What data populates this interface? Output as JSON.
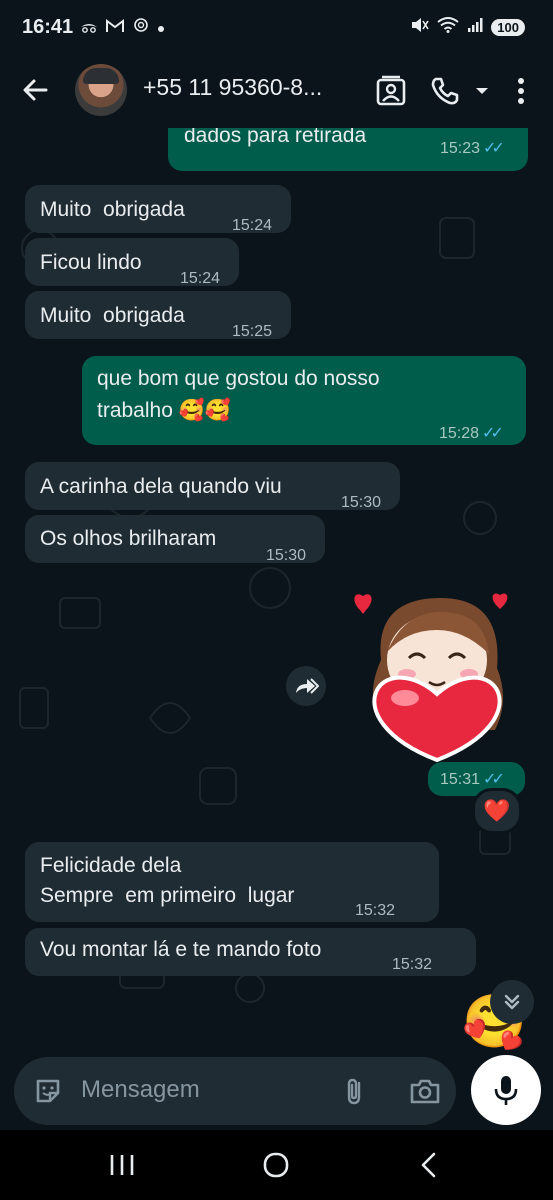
{
  "status_bar": {
    "time": "16:41",
    "battery": "100",
    "notification_icons": [
      "incognito-icon",
      "gmail-icon",
      "chatgpt-icon",
      "dot-icon"
    ],
    "system_icons": [
      "mute-icon",
      "wifi-icon",
      "signal-icon",
      "battery-icon"
    ]
  },
  "header": {
    "contact": "+55 11 95360-8...",
    "icons": [
      "back-arrow-icon",
      "avatar",
      "contact-card-icon",
      "phone-icon",
      "dropdown-icon",
      "more-icon"
    ]
  },
  "messages": [
    {
      "id": "m1",
      "dir": "out",
      "text": "dados para retirada",
      "time": "15:23",
      "status": "read"
    },
    {
      "id": "m2",
      "dir": "in",
      "text": "Muito  obrigada",
      "time": "15:24"
    },
    {
      "id": "m3",
      "dir": "in",
      "text": "Ficou lindo",
      "time": "15:24"
    },
    {
      "id": "m4",
      "dir": "in",
      "text": "Muito  obrigada",
      "time": "15:25"
    },
    {
      "id": "m5",
      "dir": "out",
      "text_line1": "que bom que gostou do nosso",
      "text_line2": "trabalho 🥰🥰",
      "time": "15:28",
      "status": "read"
    },
    {
      "id": "m6",
      "dir": "in",
      "text": "A carinha dela quando viu",
      "time": "15:30"
    },
    {
      "id": "m7",
      "dir": "in",
      "text": "Os olhos brilharam",
      "time": "15:30"
    },
    {
      "id": "m8",
      "dir": "out",
      "type": "sticker",
      "time": "15:31",
      "status": "read",
      "reaction": "❤️"
    },
    {
      "id": "m9",
      "dir": "in",
      "text_line1": "Felicidade dela",
      "text_line2": "Sempre  em primeiro  lugar",
      "time": "15:32"
    },
    {
      "id": "m10",
      "dir": "in",
      "text": "Vou montar lá e te mando foto",
      "time": "15:32"
    }
  ],
  "read_ticks": "✓✓",
  "floating_emoji": "🥰",
  "input": {
    "placeholder": "Mensagem"
  },
  "nav": [
    "recents-icon",
    "home-icon",
    "back-icon"
  ],
  "colors": {
    "background": "#0b141a",
    "incoming_bubble": "#202c33",
    "outgoing_bubble": "#005c4b",
    "read_ticks": "#53bdeb"
  }
}
